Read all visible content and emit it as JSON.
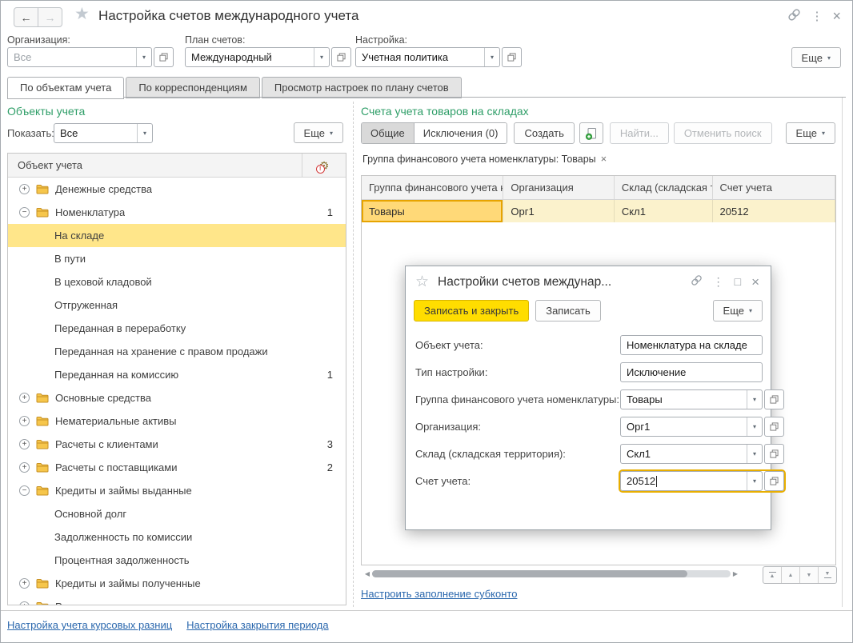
{
  "colors": {
    "heading_green": "#2f9e68",
    "link_blue": "#2a67ad",
    "accent_yellow_button": "#ffdd00",
    "tree_selection": "#ffe68a",
    "table_row_yellow": "#fbf2cc",
    "table_selected_cell": "#ffd978",
    "focus_border_orange": "#e8ae00"
  },
  "titlebar": {
    "title": "Настройка счетов международного учета"
  },
  "filters": {
    "organization": {
      "label": "Организация:",
      "placeholder": "Все"
    },
    "chart_of_accounts": {
      "label": "План счетов:",
      "value": "Международный"
    },
    "setting": {
      "label": "Настройка:",
      "value": "Учетная политика"
    },
    "more_label": "Еще"
  },
  "tabs": [
    {
      "label": "По объектам учета",
      "active": true
    },
    {
      "label": "По корреспонденциям",
      "active": false
    },
    {
      "label": "Просмотр настроек по плану счетов",
      "active": false
    }
  ],
  "left_panel": {
    "heading": "Объекты учета",
    "show_label": "Показать:",
    "show_value": "Все",
    "more_label": "Еще",
    "tree_header": "Объект учета",
    "tree": [
      {
        "label": "Денежные средства",
        "type": "group",
        "state": "collapsed"
      },
      {
        "label": "Номенклатура",
        "type": "group",
        "state": "expanded",
        "count": "1"
      },
      {
        "label": "На складе",
        "type": "item",
        "selected": true
      },
      {
        "label": "В пути",
        "type": "item"
      },
      {
        "label": "В цеховой кладовой",
        "type": "item"
      },
      {
        "label": "Отгруженная",
        "type": "item"
      },
      {
        "label": "Переданная в переработку",
        "type": "item"
      },
      {
        "label": "Переданная на хранение с правом продажи",
        "type": "item"
      },
      {
        "label": "Переданная на комиссию",
        "type": "item",
        "count": "1"
      },
      {
        "label": "Основные средства",
        "type": "group",
        "state": "collapsed"
      },
      {
        "label": "Нематериальные активы",
        "type": "group",
        "state": "collapsed"
      },
      {
        "label": "Расчеты с клиентами",
        "type": "group",
        "state": "collapsed",
        "count": "3"
      },
      {
        "label": "Расчеты с поставщиками",
        "type": "group",
        "state": "collapsed",
        "count": "2"
      },
      {
        "label": "Кредиты и займы выданные",
        "type": "group",
        "state": "expanded"
      },
      {
        "label": "Основной долг",
        "type": "item"
      },
      {
        "label": "Задолженность по комиссии",
        "type": "item"
      },
      {
        "label": "Процентная задолженность",
        "type": "item"
      },
      {
        "label": "Кредиты и займы полученные",
        "type": "group",
        "state": "collapsed"
      },
      {
        "label": "Расчеты с сотрудниками",
        "type": "group",
        "state": "collapsed"
      }
    ],
    "footer_links": [
      "Настройка учета курсовых разниц",
      "Настройка закрытия периода"
    ]
  },
  "right_panel": {
    "heading": "Счета учета товаров на складах",
    "toolbar": {
      "common": "Общие",
      "exceptions": "Исключения (0)",
      "create": "Создать",
      "find": "Найти...",
      "cancel_search": "Отменить поиск",
      "more": "Еще"
    },
    "filter_chip": "Группа финансового учета номенклатуры: Товары",
    "table": {
      "columns": [
        {
          "label": "Группа финансового учета но...",
          "width": 178
        },
        {
          "label": "Организация",
          "width": 139
        },
        {
          "label": "Склад (складская т...",
          "width": 123
        },
        {
          "label": "Счет учета",
          "width": 154
        }
      ],
      "rows": [
        {
          "cells": [
            "Товары",
            "Орг1",
            "Скл1",
            "20512"
          ],
          "selected_cell": 0
        }
      ]
    },
    "footer_link": "Настроить заполнение субконто"
  },
  "dialog": {
    "title": "Настройки счетов междунар...",
    "save_close_label": "Записать и закрыть",
    "save_label": "Записать",
    "more_label": "Еще",
    "fields": [
      {
        "name": "object",
        "label": "Объект учета:",
        "value": "Номенклатура на складе",
        "type": "text"
      },
      {
        "name": "setting-type",
        "label": "Тип настройки:",
        "value": "Исключение",
        "type": "text"
      },
      {
        "name": "fin-group",
        "label": "Группа финансового учета номенклатуры:",
        "value": "Товары",
        "type": "combo"
      },
      {
        "name": "organization",
        "label": "Организация:",
        "value": "Орг1",
        "type": "combo"
      },
      {
        "name": "warehouse",
        "label": "Склад (складская территория):",
        "value": "Скл1",
        "type": "combo"
      },
      {
        "name": "account",
        "label": "Счет учета:",
        "value": "20512",
        "type": "combo",
        "focused": true
      }
    ]
  }
}
